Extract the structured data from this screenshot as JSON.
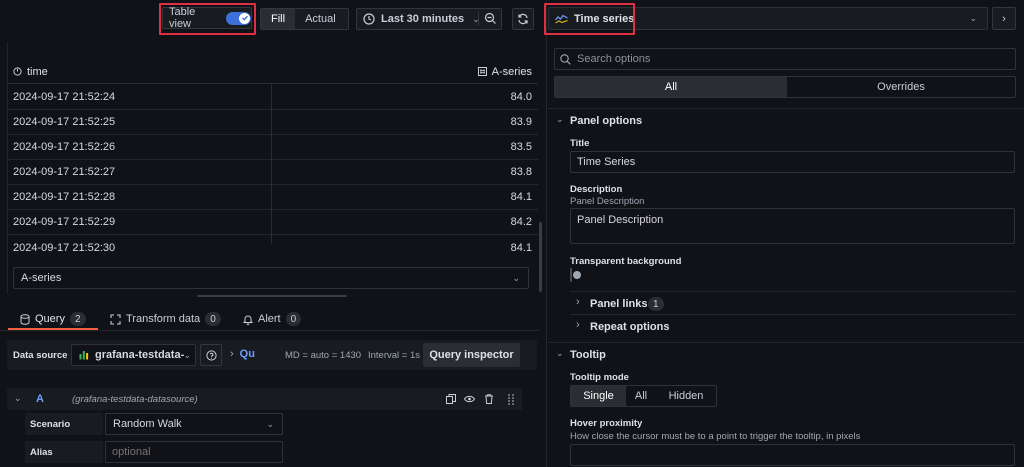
{
  "toolbar": {
    "table_view_label": "Table view",
    "fill_label": "Fill",
    "actual_label": "Actual",
    "time_range_label": "Last 30 minutes"
  },
  "table": {
    "columns": [
      "time",
      "A-series"
    ],
    "rows": [
      {
        "time": "2024-09-17 21:52:24",
        "value": "84.0"
      },
      {
        "time": "2024-09-17 21:52:25",
        "value": "83.9"
      },
      {
        "time": "2024-09-17 21:52:26",
        "value": "83.5"
      },
      {
        "time": "2024-09-17 21:52:27",
        "value": "83.8"
      },
      {
        "time": "2024-09-17 21:52:28",
        "value": "84.1"
      },
      {
        "time": "2024-09-17 21:52:29",
        "value": "84.2"
      },
      {
        "time": "2024-09-17 21:52:30",
        "value": "84.1"
      }
    ],
    "series_select": "A-series"
  },
  "tabs": [
    {
      "label": "Query",
      "count": "2"
    },
    {
      "label": "Transform data",
      "count": "0"
    },
    {
      "label": "Alert",
      "count": "0"
    }
  ],
  "query": {
    "datasource_label": "Data source",
    "datasource_value": "grafana-testdata-",
    "options_short": "Qu",
    "md_text": "MD = auto = 1430",
    "interval_text": "Interval = 1s",
    "inspector_label": "Query inspector",
    "row_letter": "A",
    "row_source": "(grafana-testdata-datasource)",
    "scenario_label": "Scenario",
    "scenario_value": "Random Walk",
    "alias_label": "Alias",
    "alias_placeholder": "optional"
  },
  "panel": {
    "viz_label": "Time series",
    "search_placeholder": "Search options",
    "tab_all": "All",
    "tab_overrides": "Overrides",
    "panel_options_title": "Panel options",
    "title_label": "Title",
    "title_value": "Time Series",
    "description_label": "Description",
    "description_hint": "Panel Description",
    "description_value": "Panel Description",
    "transparent_label": "Transparent background",
    "panel_links_label": "Panel links",
    "panel_links_count": "1",
    "repeat_label": "Repeat options",
    "tooltip_title": "Tooltip",
    "tooltip_mode_label": "Tooltip mode",
    "tooltip_modes": [
      "Single",
      "All",
      "Hidden"
    ],
    "hover_label": "Hover proximity",
    "hover_desc": "How close the cursor must be to a point to trigger the tooltip, in pixels"
  },
  "colors": {
    "accent": "#3d71d9",
    "highlight": "#e02f44",
    "tab_active": "#f55f3e"
  }
}
